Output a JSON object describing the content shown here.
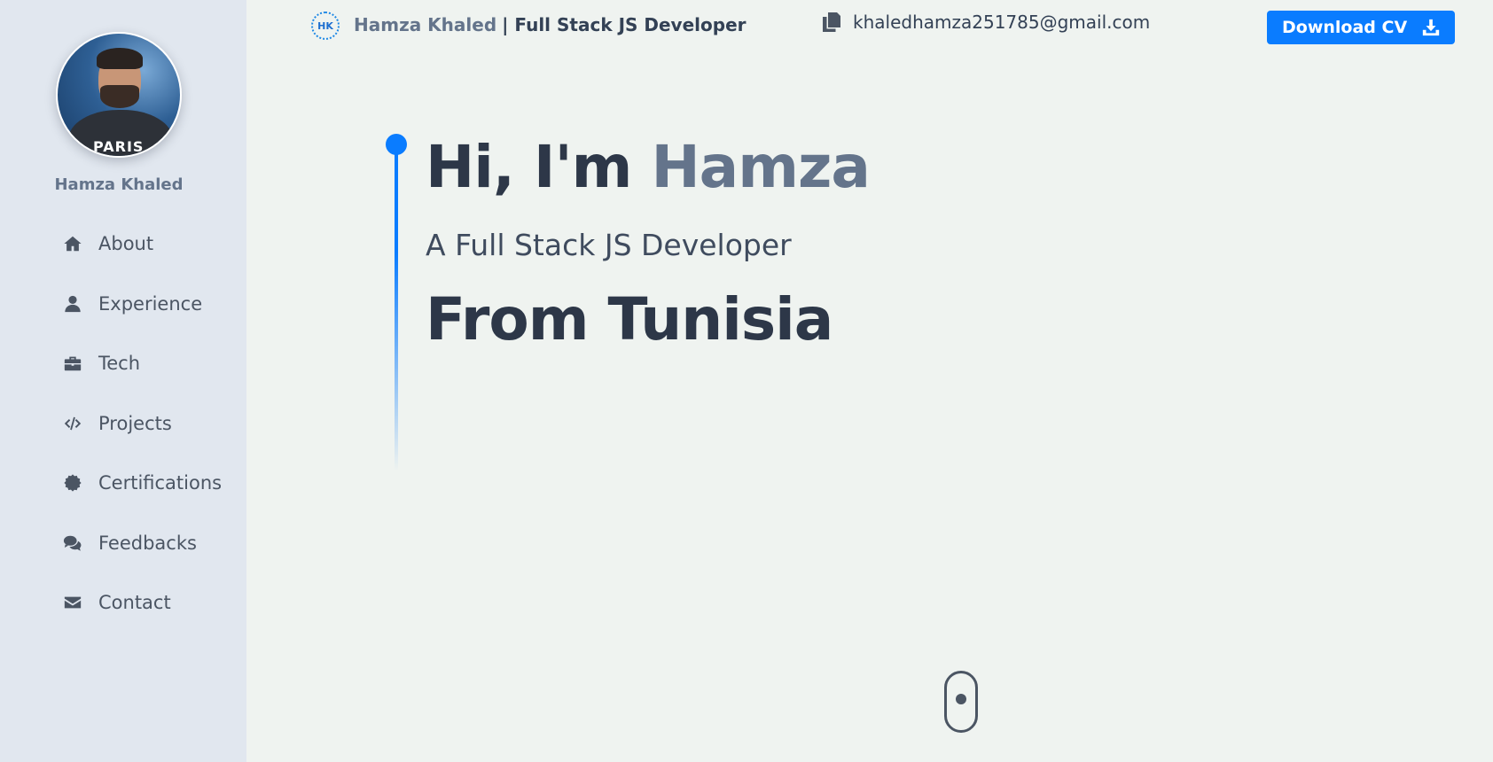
{
  "sidebar": {
    "profile_name": "Hamza Khaled",
    "avatar_shirt_text": "PARIS",
    "items": [
      {
        "label": "About",
        "icon": "home-icon"
      },
      {
        "label": "Experience",
        "icon": "user-icon"
      },
      {
        "label": "Tech",
        "icon": "briefcase-icon"
      },
      {
        "label": "Projects",
        "icon": "code-icon"
      },
      {
        "label": "Certifications",
        "icon": "certificate-icon"
      },
      {
        "label": "Feedbacks",
        "icon": "comments-icon"
      },
      {
        "label": "Contact",
        "icon": "envelope-icon"
      }
    ]
  },
  "header": {
    "logo_initials": "HK",
    "brand_name": "Hamza Khaled",
    "brand_role": "| Full Stack JS Developer",
    "email": "khaledhamza251785@gmail.com",
    "download_cv_label": "Download CV"
  },
  "hero": {
    "greeting": "Hi, I'm",
    "name": "Hamza",
    "subtitle": "A Full Stack JS Developer",
    "origin": "From Tunisia"
  },
  "colors": {
    "accent": "#0a7cff",
    "sidebar_bg": "#e1e7ef",
    "page_bg": "#eff3f0",
    "heading": "#2d3748",
    "muted": "#64748b"
  }
}
